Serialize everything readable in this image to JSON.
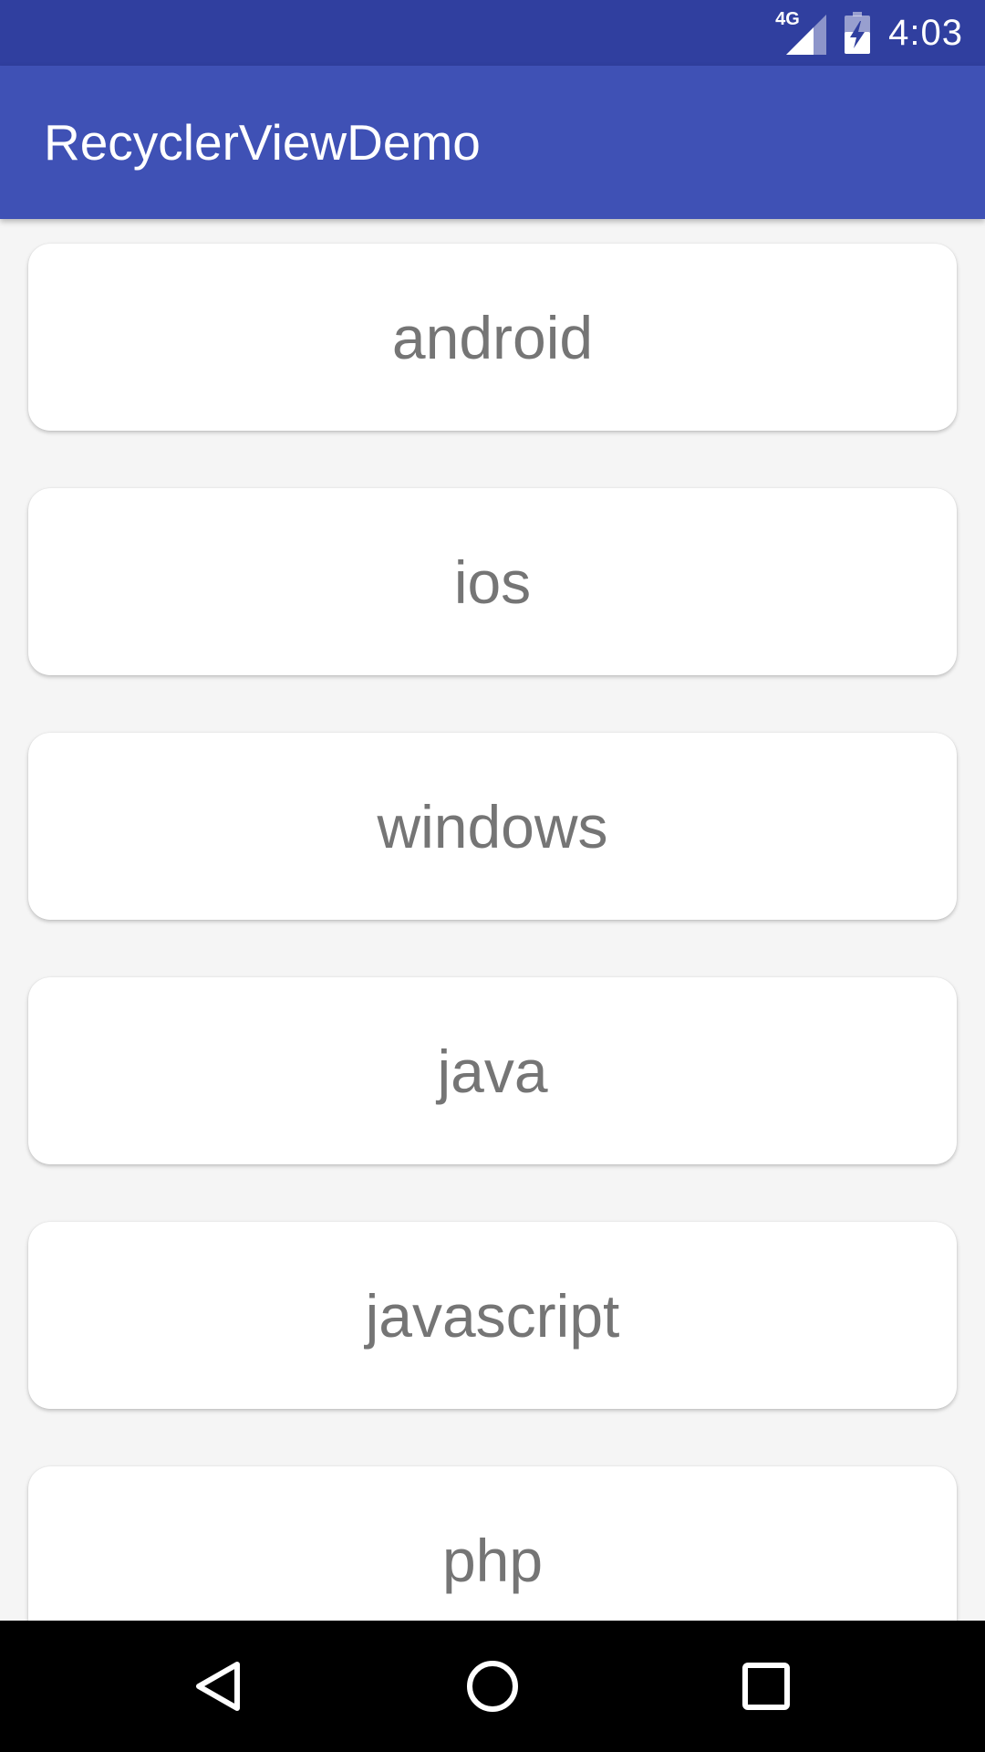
{
  "status_bar": {
    "network": "4G",
    "time": "4:03",
    "icons": [
      "signal-icon",
      "battery-charging-icon"
    ]
  },
  "app_bar": {
    "title": "RecyclerViewDemo"
  },
  "list": {
    "items": [
      {
        "label": "android"
      },
      {
        "label": "ios"
      },
      {
        "label": "windows"
      },
      {
        "label": "java"
      },
      {
        "label": "javascript"
      },
      {
        "label": "php"
      }
    ]
  },
  "nav_bar": {
    "icons": [
      "back-icon",
      "home-icon",
      "recents-icon"
    ]
  },
  "colors": {
    "status_bar": "#303F9F",
    "app_bar": "#3F51B5",
    "background": "#F5F5F5",
    "card": "#FFFFFF",
    "card_text": "#757575",
    "nav_bar": "#000000"
  }
}
